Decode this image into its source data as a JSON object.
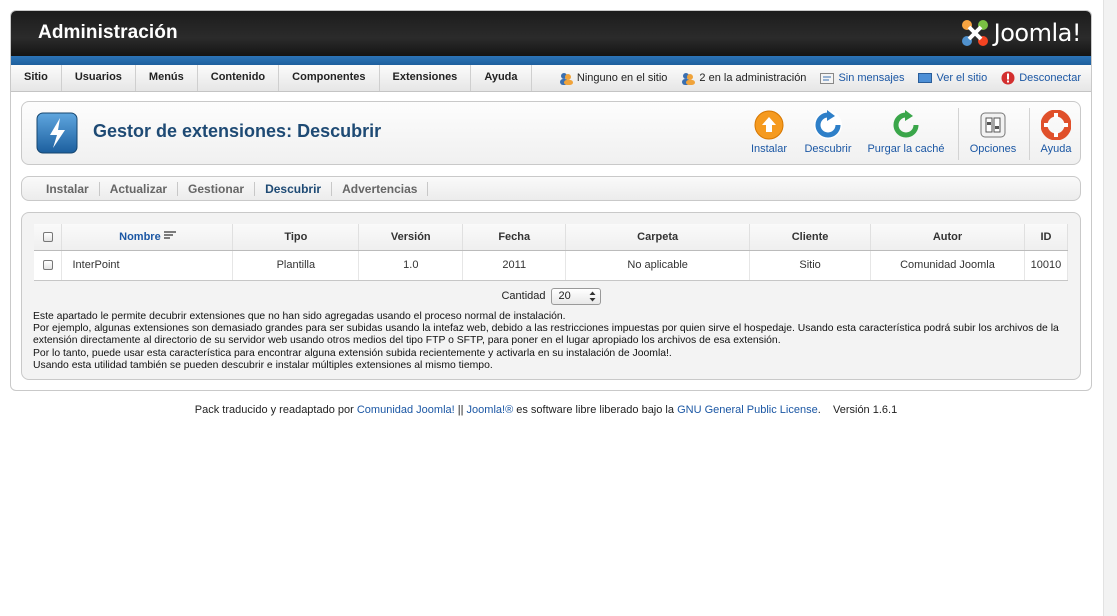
{
  "header": {
    "title": "Administración",
    "logo_text": "Joomla!"
  },
  "menu": {
    "items": [
      "Sitio",
      "Usuarios",
      "Menús",
      "Contenido",
      "Componentes",
      "Extensiones",
      "Ayuda"
    ]
  },
  "status": {
    "site_users": "Ninguno en el sitio",
    "admin_users": "2 en la administración",
    "messages": "Sin mensajes",
    "view_site": "Ver el sitio",
    "logout": "Desconectar"
  },
  "toolbar": {
    "title": "Gestor de extensiones: Descubrir",
    "install": "Instalar",
    "discover": "Descubrir",
    "purge": "Purgar la caché",
    "options": "Opciones",
    "help": "Ayuda"
  },
  "subtabs": [
    "Instalar",
    "Actualizar",
    "Gestionar",
    "Descubrir",
    "Advertencias"
  ],
  "subtabs_active": "Descubrir",
  "table": {
    "headers": [
      "Nombre",
      "Tipo",
      "Versión",
      "Fecha",
      "Carpeta",
      "Cliente",
      "Autor",
      "ID"
    ],
    "rows": [
      {
        "nombre": "InterPoint",
        "tipo": "Plantilla",
        "version": "1.0",
        "fecha": "2011",
        "carpeta": "No aplicable",
        "cliente": "Sitio",
        "autor": "Comunidad Joomla",
        "id": "10010"
      }
    ]
  },
  "pager": {
    "label": "Cantidad",
    "value": "20"
  },
  "description": [
    "Este apartado le permite decubrir extensiones que no han sido agregadas usando el proceso normal de instalación.",
    "Por ejemplo, algunas extensiones son demasiado grandes para ser subidas usando la intefaz web, debido a las restricciones impuestas por quien sirve el hospedaje. Usando esta característica podrá subir los archivos de la extensión directamente al directorio de su servidor web usando otros medios del tipo FTP o SFTP, para poner en el lugar apropiado los archivos de esa extensión.",
    "Por lo tanto, puede usar esta característica para encontrar alguna extensión subida recientemente y activarla en su instalación de Joomla!.",
    "Usando esta utilidad también se pueden descubrir e instalar múltiples extensiones al mismo tiempo."
  ],
  "footer": {
    "prefix": "Pack traducido y readaptado por",
    "community": "Comunidad Joomla!",
    "sep": "||",
    "joomla": "Joomla!®",
    "middle": "es software libre liberado bajo la",
    "license": "GNU General Public License",
    "version": "Versión 1.6.1"
  },
  "colors": {
    "accent_blue": "#1d5f9d",
    "link": "#1b57a4",
    "title": "#1e4a74"
  }
}
